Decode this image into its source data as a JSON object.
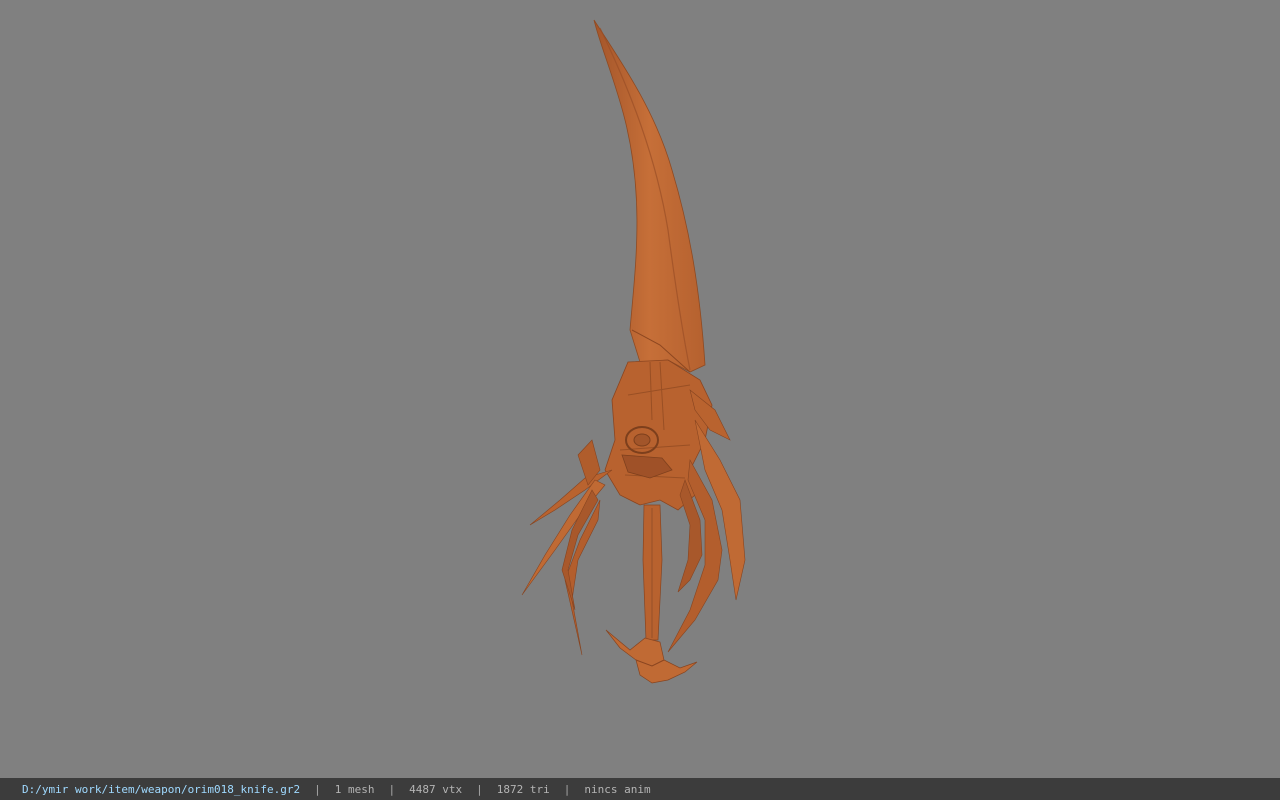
{
  "viewport": {
    "background_color": "#808080",
    "model_color": "#c06a34",
    "model": "orim018_knife"
  },
  "status_bar": {
    "file_path": "D:/ymir work/item/weapon/orim018_knife.gr2",
    "separator": "|",
    "mesh_count": "1 mesh",
    "vertex_count": "4487 vtx",
    "triangle_count": "1872 tri",
    "anim_status": "nincs anim"
  }
}
